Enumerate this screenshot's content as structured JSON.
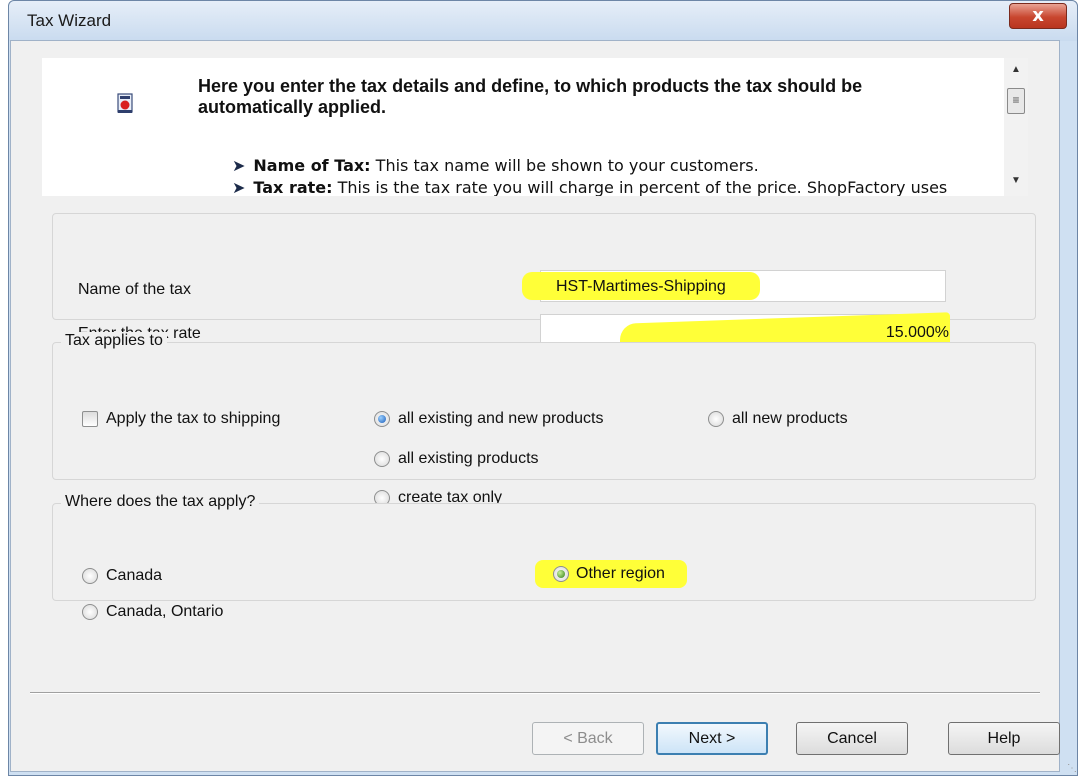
{
  "window": {
    "title": "Tax Wizard",
    "close_glyph": "x"
  },
  "info": {
    "heading": "Here you enter the tax details and define, to which products the tax should be automatically applied.",
    "bullets": [
      {
        "term": "Name of Tax:",
        "text": "This tax name will be shown to your customers."
      },
      {
        "term": "Tax rate:",
        "text": "This is the tax rate you will charge in percent of the price. ShopFactory uses"
      }
    ],
    "icon": "tax-wizard-icon"
  },
  "tax_fields": {
    "name_label": "Name of the tax",
    "name_value": "HST-Martimes-Shipping",
    "rate_label": "Enter the tax rate",
    "rate_value": "15.000%"
  },
  "applies": {
    "legend": "Tax applies to",
    "shipping_label": "Apply the tax to shipping",
    "shipping_checked": false,
    "options": [
      {
        "label": "all existing and new products",
        "checked": true
      },
      {
        "label": "all new products",
        "checked": false
      },
      {
        "label": "all existing products",
        "checked": false
      },
      {
        "label": "create tax only",
        "checked": false
      }
    ]
  },
  "where": {
    "legend": "Where does the tax apply?",
    "options": [
      {
        "label": "Canada",
        "checked": false
      },
      {
        "label": "Other region",
        "checked": true
      },
      {
        "label": "Canada, Ontario",
        "checked": false
      }
    ]
  },
  "buttons": {
    "back": "< Back",
    "next": "Next >",
    "cancel": "Cancel",
    "help": "Help"
  },
  "colors": {
    "highlight": "#ffff38",
    "close_button": "#c8462f"
  }
}
